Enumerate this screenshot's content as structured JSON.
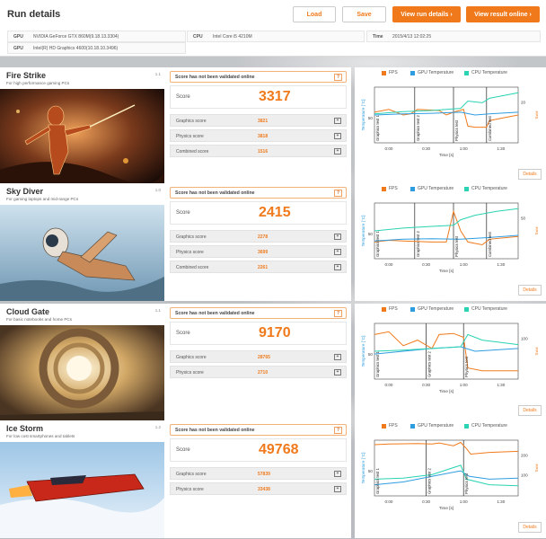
{
  "header": {
    "title": "Run details",
    "load_label": "Load",
    "save_label": "Save",
    "view_run_label": "View run details",
    "view_online_label": "View result online",
    "gpu_label": "GPU",
    "gpu1": "NVIDIA GeForce GTX 860M(9.18.13.3304)",
    "gpu2": "Intel(R) HD Graphics 4600(10.18.10.3496)",
    "cpu_label": "CPU",
    "cpu": "Intel Core i5 4210M",
    "time_label": "Time",
    "time": "2015/4/13 12:02:25"
  },
  "common": {
    "not_validated": "Score has not been validated online",
    "question_mark": "?",
    "score_label": "Score",
    "details_label": "Details",
    "legend_fps": "FPS",
    "legend_gpu": "GPU Temperature",
    "legend_cpu": "CPU Temperature",
    "time_axis": "Time [s]",
    "temp_axis": "Temperature [°C]",
    "fps_axis": "FPS"
  },
  "colors": {
    "accent": "#f07a1b",
    "fps": "#f07a1b",
    "gpu": "#2e9de0",
    "cpu": "#29d3b3"
  },
  "tests": [
    {
      "name": "Fire Strike",
      "desc": "For high performance gaming PCs",
      "version": "1.1",
      "score": "3317",
      "subs": [
        {
          "label": "Graphics score",
          "value": "3821"
        },
        {
          "label": "Physics score",
          "value": "3818"
        },
        {
          "label": "Combined score",
          "value": "1516"
        }
      ],
      "chart": {
        "x_ticks": [
          "0:00",
          "0:30",
          "1:00",
          "1:30"
        ],
        "y_left_ticks": [
          "50"
        ],
        "y_right_ticks": [
          "20"
        ],
        "phases": [
          "Graphics test 1",
          "Graphics test 2",
          "Physics test",
          "Combined test"
        ]
      }
    },
    {
      "name": "Sky Diver",
      "desc": "For gaming laptops and mid-range PCs",
      "version": "1.0",
      "score": "2415",
      "subs": [
        {
          "label": "Graphics score",
          "value": "2278"
        },
        {
          "label": "Physics score",
          "value": "3699"
        },
        {
          "label": "Combined score",
          "value": "2261"
        }
      ],
      "chart": {
        "x_ticks": [
          "0:00",
          "0:30",
          "1:00",
          "1:30"
        ],
        "y_left_ticks": [
          "50"
        ],
        "y_right_ticks": [
          "50"
        ],
        "phases": [
          "Graphics test 1",
          "Graphics test 2",
          "Physics test",
          "Combined test"
        ]
      }
    },
    {
      "name": "Cloud Gate",
      "desc": "For basic notebooks and home PCs",
      "version": "1.1",
      "score": "9170",
      "subs": [
        {
          "label": "Graphics score",
          "value": "28765"
        },
        {
          "label": "Physics score",
          "value": "2710"
        }
      ],
      "chart": {
        "x_ticks": [
          "0:00",
          "0:30",
          "1:00",
          "1:30"
        ],
        "y_left_ticks": [
          "50"
        ],
        "y_right_ticks": [
          "100"
        ],
        "phases": [
          "Graphics test 1",
          "Graphics test 2",
          "Physics test"
        ]
      }
    },
    {
      "name": "Ice Storm",
      "desc": "For low cost smartphones and tablets",
      "version": "1.2",
      "score": "49768",
      "subs": [
        {
          "label": "Graphics score",
          "value": "57839"
        },
        {
          "label": "Physics score",
          "value": "33438"
        }
      ],
      "chart": {
        "x_ticks": [
          "0:00",
          "0:30",
          "1:00",
          "1:30"
        ],
        "y_left_ticks": [
          "50"
        ],
        "y_right_ticks": [
          "200",
          "100"
        ],
        "phases": [
          "Graphics test 1",
          "Graphics test 2",
          "Physics test"
        ]
      }
    }
  ]
}
